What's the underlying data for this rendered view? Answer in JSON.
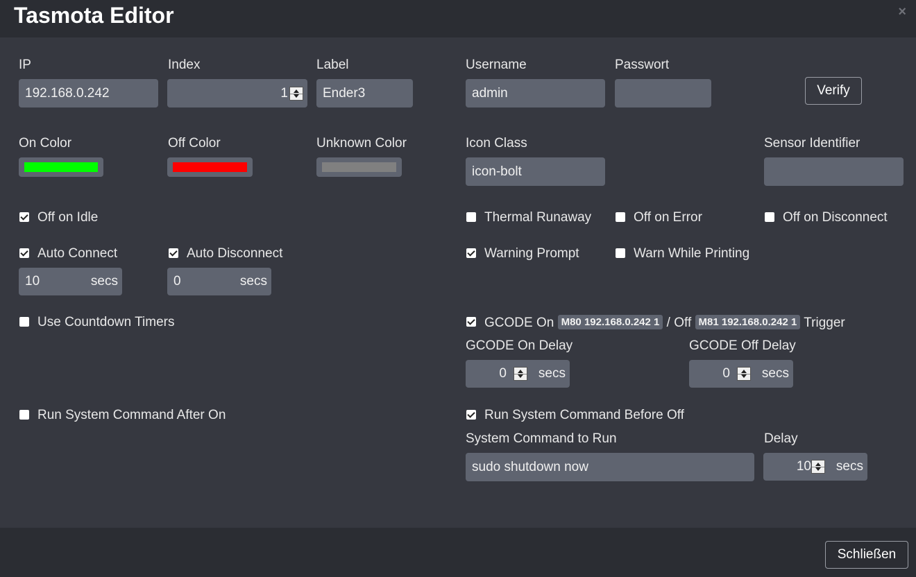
{
  "dialog": {
    "title": "Tasmota Editor",
    "close_glyph": "×",
    "close_button_label": "Schließen"
  },
  "fields": {
    "ip": {
      "label": "IP",
      "value": "192.168.0.242"
    },
    "index": {
      "label": "Index",
      "value": "1"
    },
    "label": {
      "label": "Label",
      "value": "Ender3"
    },
    "username": {
      "label": "Username",
      "value": "admin"
    },
    "password": {
      "label": "Passwort",
      "value": ""
    },
    "verify_label": "Verify",
    "on_color": {
      "label": "On Color",
      "color": "#00ff00"
    },
    "off_color": {
      "label": "Off Color",
      "color": "#ff0000"
    },
    "unknown_color": {
      "label": "Unknown Color",
      "color": "#808080"
    },
    "icon_class": {
      "label": "Icon Class",
      "value": "icon-bolt"
    },
    "sensor_identifier": {
      "label": "Sensor Identifier",
      "value": ""
    }
  },
  "checkboxes": {
    "off_on_idle": {
      "label": "Off on Idle",
      "checked": true
    },
    "thermal_runaway": {
      "label": "Thermal Runaway",
      "checked": false
    },
    "off_on_error": {
      "label": "Off on Error",
      "checked": false
    },
    "off_on_disconnect": {
      "label": "Off on Disconnect",
      "checked": false
    },
    "auto_connect": {
      "label": "Auto Connect",
      "checked": true
    },
    "auto_disconnect": {
      "label": "Auto Disconnect",
      "checked": true
    },
    "warning_prompt": {
      "label": "Warning Prompt",
      "checked": true
    },
    "warn_while_printing": {
      "label": "Warn While Printing",
      "checked": false
    },
    "use_countdown_timers": {
      "label": "Use Countdown Timers",
      "checked": false
    },
    "gcode_trigger": {
      "checked": true
    },
    "run_after_on": {
      "label": "Run System Command After On",
      "checked": false
    },
    "run_before_off": {
      "label": "Run System Command Before Off",
      "checked": true
    }
  },
  "unit_secs": "secs",
  "auto_connect_delay": "10",
  "auto_disconnect_delay": "0",
  "gcode": {
    "on_text": "GCODE On",
    "on_command": "M80 192.168.0.242 1",
    "off_text": "/ Off",
    "off_command": "M81 192.168.0.242 1",
    "trigger_text": "Trigger",
    "on_delay": {
      "label": "GCODE On Delay",
      "value": "0"
    },
    "off_delay": {
      "label": "GCODE Off Delay",
      "value": "0"
    }
  },
  "system_command": {
    "label": "System Command to Run",
    "value": "sudo shutdown now",
    "delay_label": "Delay",
    "delay_value": "10"
  }
}
